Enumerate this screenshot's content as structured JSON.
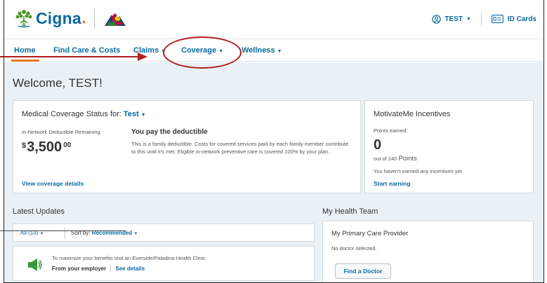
{
  "header": {
    "brand": "Cigna",
    "user_label": "TEST",
    "id_cards_label": "ID Cards"
  },
  "nav": {
    "items": [
      {
        "label": "Home"
      },
      {
        "label": "Find Care & Costs"
      },
      {
        "label": "Claims"
      },
      {
        "label": "Coverage"
      },
      {
        "label": "Wellness"
      }
    ]
  },
  "main": {
    "welcome": "Welcome, TEST!",
    "coverage": {
      "title_prefix": "Medical Coverage Status for: ",
      "plan_name": "Test",
      "deductible_label": "In-Network Deductible Remaining",
      "currency": "$",
      "amount": "3,500",
      "cents": "00",
      "pay_heading": "You pay the deductible",
      "pay_description": "This is a family deductible. Costs for covered services paid by each family member contribute to this until it's met. Eligible in-network preventive care is covered 100% by your plan.",
      "details_link": "View coverage details"
    },
    "motivateme": {
      "title": "MotivateMe Incentives",
      "points_label": "Points earned:",
      "points": "0",
      "out_of_prefix": "out of 240",
      "out_of_unit": "Points",
      "status": "You haven't earned any incentives yet.",
      "link": "Start earning"
    },
    "updates": {
      "title": "Latest Updates",
      "filter": "All (14)",
      "sort_label": "Sort by:",
      "sort_value": "Recommended",
      "item_text": "To maximize your benefits visit an Everside/Paladina Health Clinic",
      "item_source": "From your employer",
      "item_link": "See details"
    },
    "team": {
      "title": "My Health Team",
      "pcp_title": "My Primary Care Provider",
      "pcp_status": "No doctor selected.",
      "find_button": "Find a Doctor"
    }
  },
  "colors": {
    "brand_blue": "#0a6aa1",
    "accent_orange": "#e37822",
    "annotation_red": "#b01e1e",
    "main_bg": "#e9f1f7"
  }
}
